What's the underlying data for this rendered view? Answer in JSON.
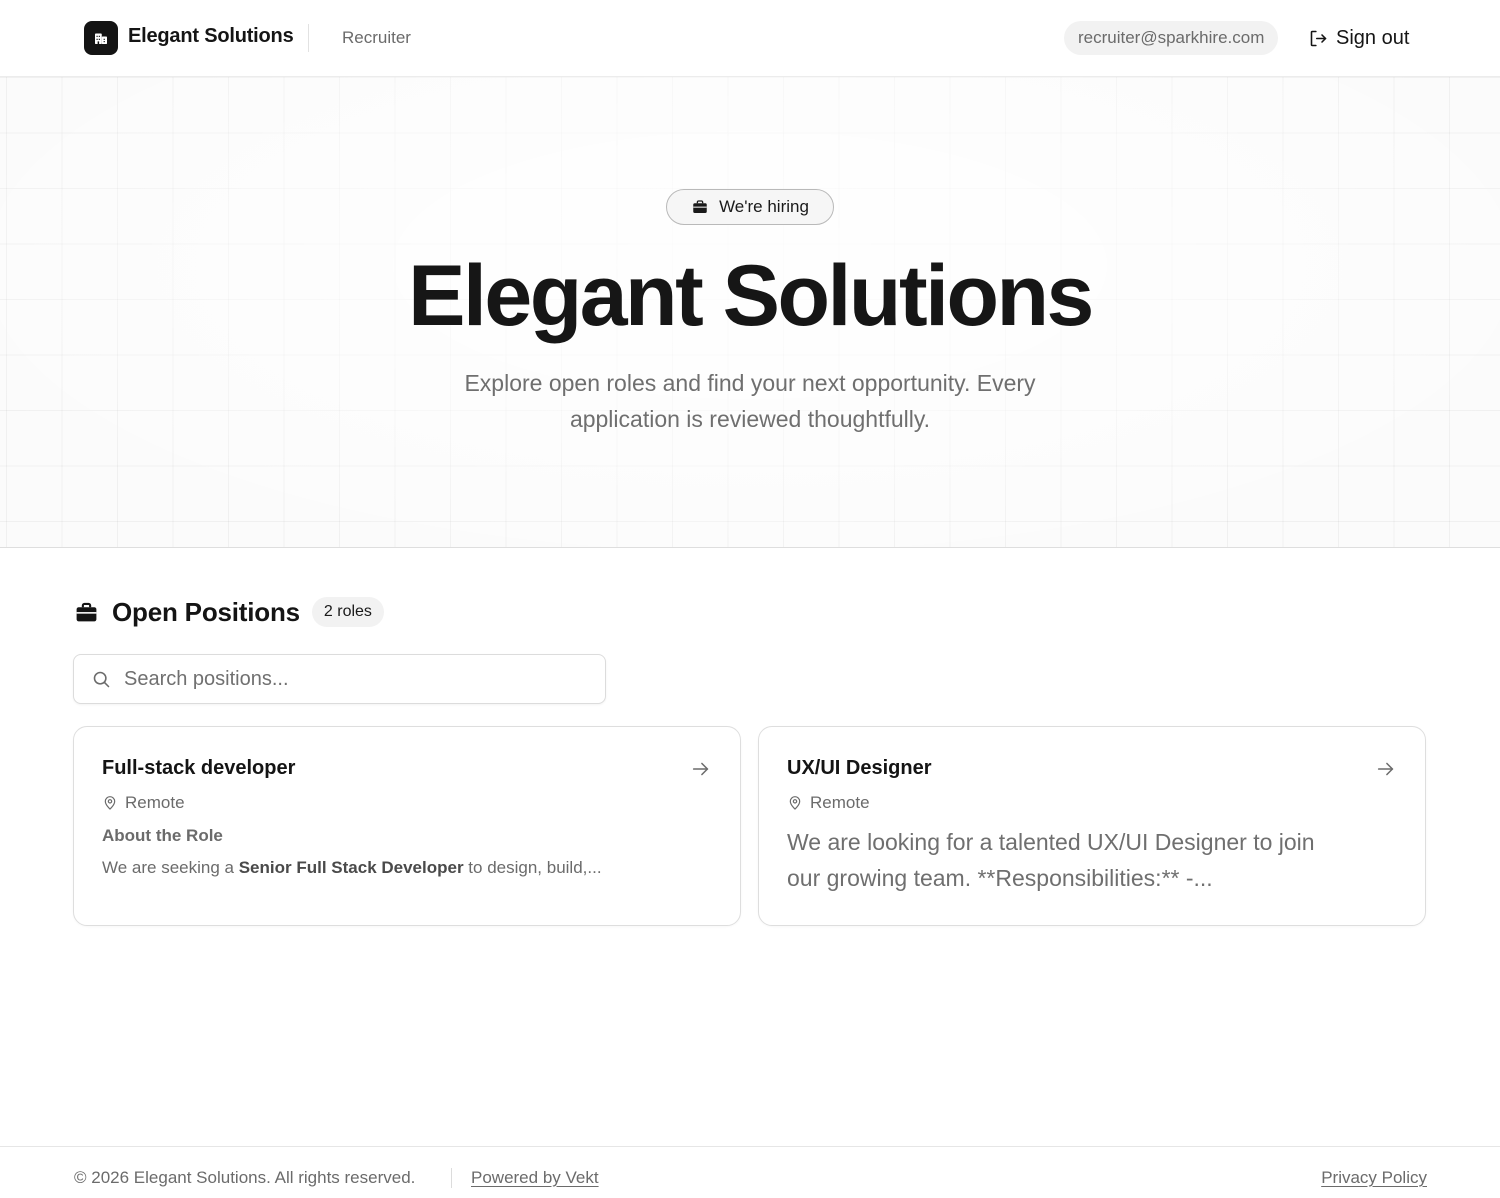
{
  "header": {
    "brand_name": "Elegant Solutions",
    "role": "Recruiter",
    "email": "recruiter@sparkhire.com",
    "signout_label": "Sign out",
    "logo_icon": "building-icon"
  },
  "hero": {
    "badge": "We're hiring",
    "title": "Elegant Solutions",
    "subtitle": "Explore open roles and find your next opportunity. Every application is reviewed thoughtfully."
  },
  "positions": {
    "title": "Open Positions",
    "count": "2 roles",
    "search_placeholder": "Search positions...",
    "jobs": [
      {
        "title": "Full-stack developer",
        "location": "Remote",
        "heading": "About the Role",
        "desc_pre": "We are seeking a ",
        "desc_bold": "Senior Full Stack Developer",
        "desc_post": " to design, build,..."
      },
      {
        "title": "UX/UI Designer",
        "location": "Remote",
        "description": "We are looking for a talented UX/UI Designer to join our growing team. **Responsibilities:** -..."
      }
    ]
  },
  "footer": {
    "copyright": "© 2026 Elegant Solutions. All rights reserved.",
    "powered": "Powered by Vekt",
    "privacy": "Privacy Policy"
  },
  "colors": {
    "text_primary": "#141414",
    "text_muted": "#6b6b6b",
    "logo_bg": "#141414",
    "border": "#dedede"
  }
}
